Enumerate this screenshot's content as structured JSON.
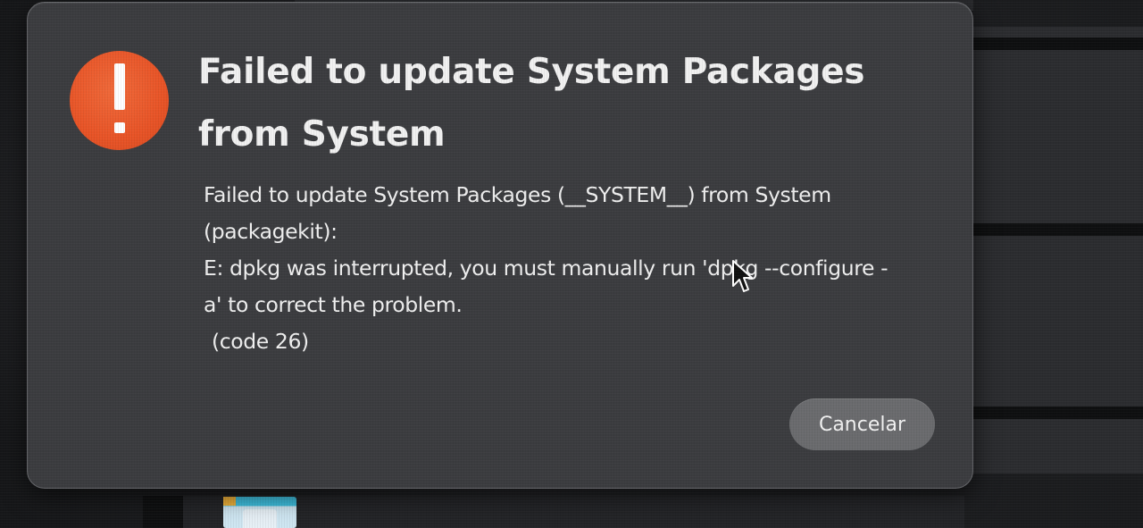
{
  "dialog": {
    "icon": "exclamation-icon",
    "title": "Failed to update System Packages from System",
    "message": {
      "line1": "Failed to update System Packages (__SYSTEM__) from System",
      "line2": "(packagekit):",
      "line3": "E: dpkg was interrupted, you must manually run 'dpkg --configure -",
      "line4": "a' to correct the problem.",
      "line5": "(code 26)"
    },
    "cancel_label": "Cancelar"
  },
  "colors": {
    "error_icon": "#e85427",
    "dialog_background": "#3b3c3f",
    "button_background": "#6a6b6e",
    "text": "#f0f0f0"
  }
}
